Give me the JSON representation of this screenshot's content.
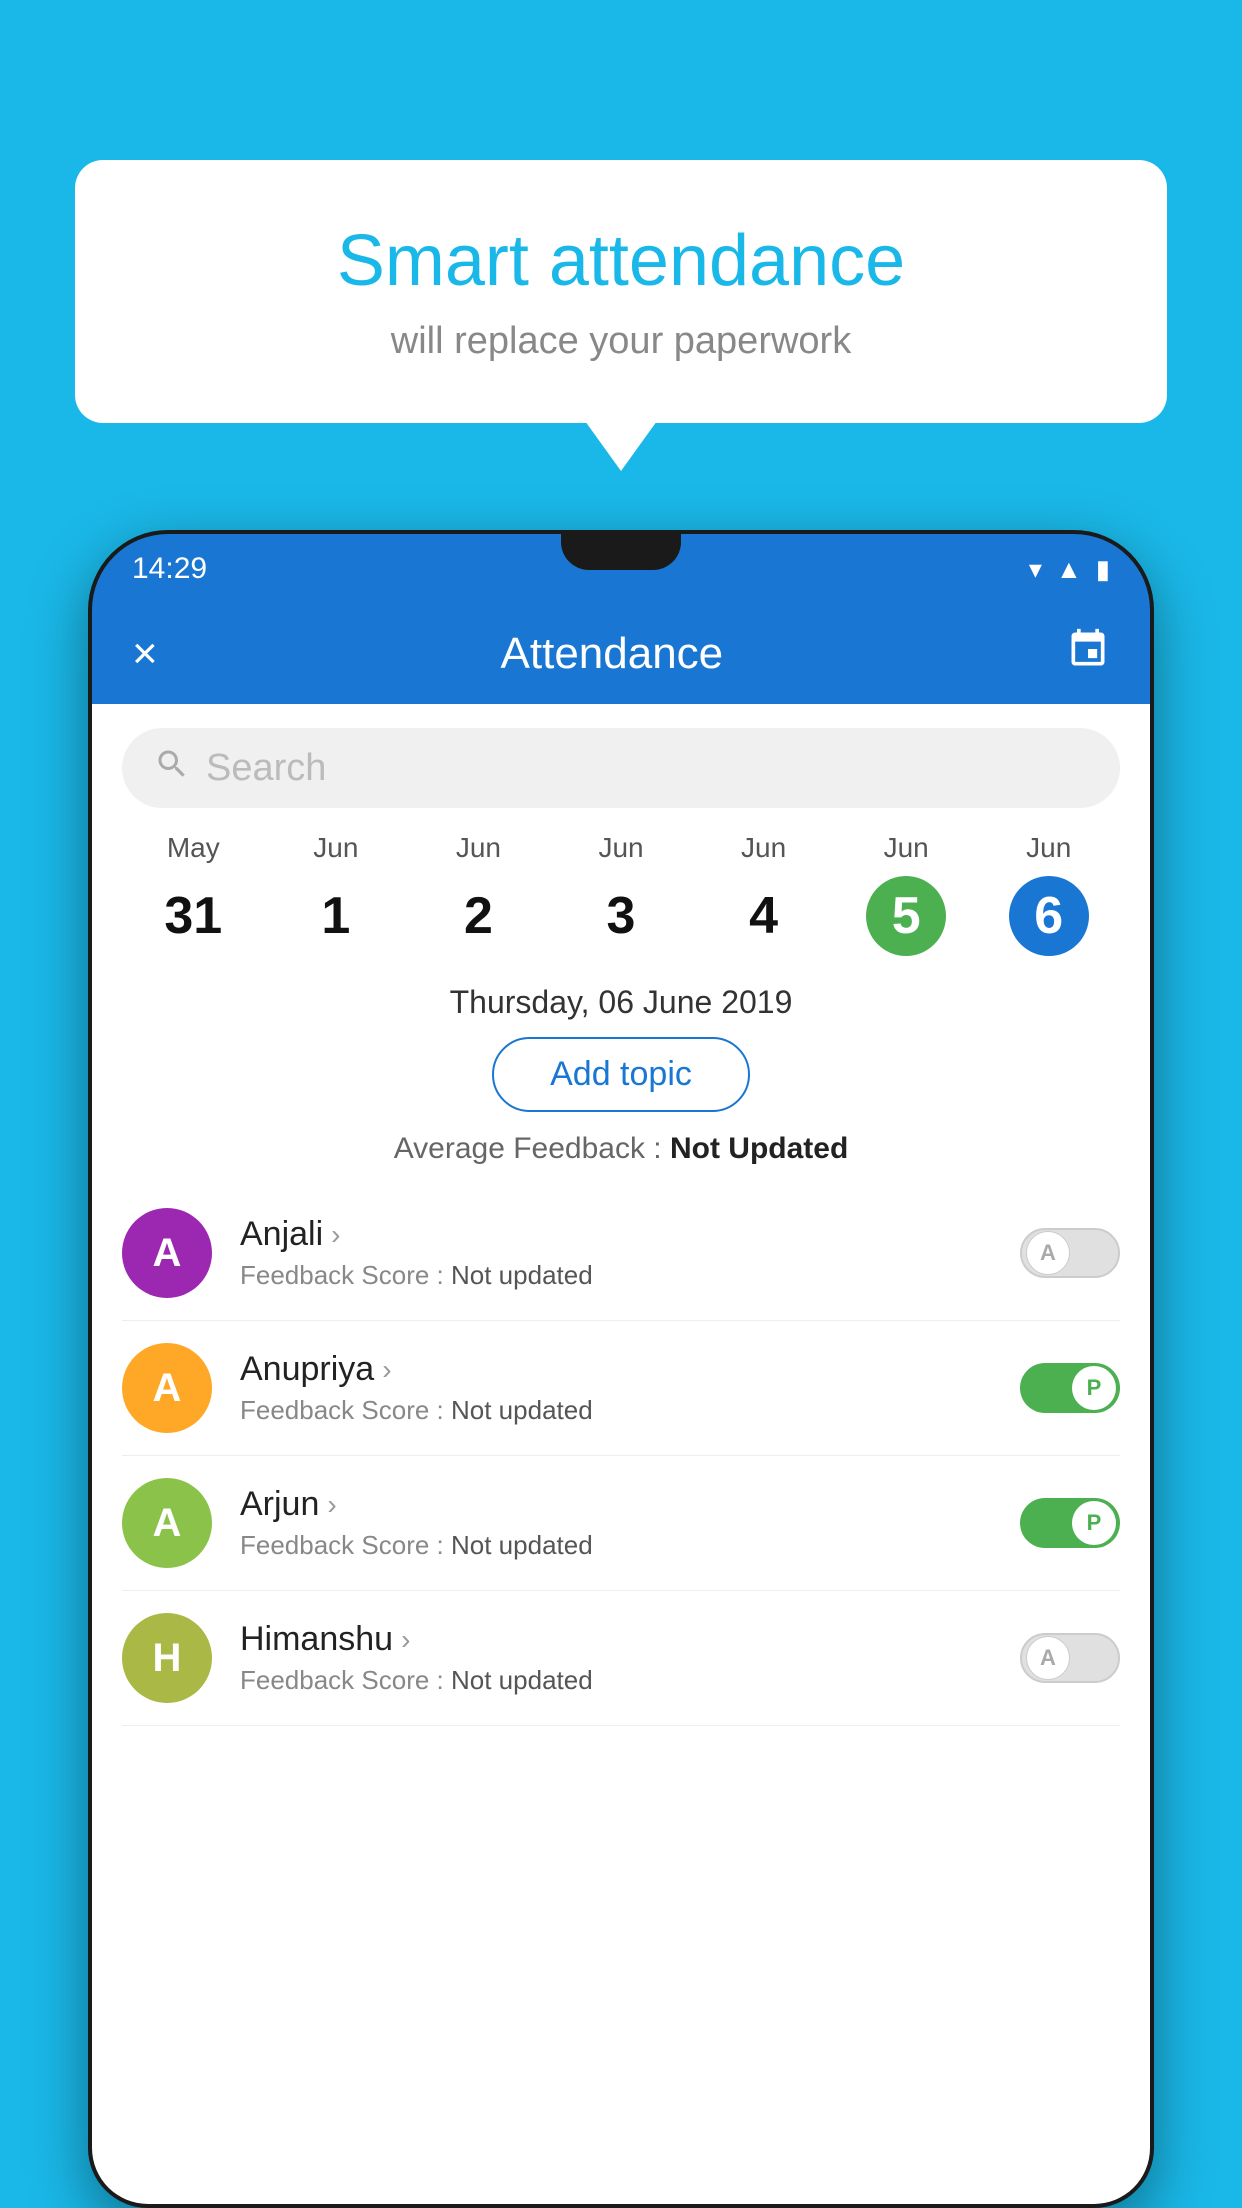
{
  "background_color": "#1ab8e8",
  "bubble": {
    "title": "Smart attendance",
    "subtitle": "will replace your paperwork"
  },
  "status_bar": {
    "time": "14:29",
    "icons": [
      "wifi",
      "signal",
      "battery"
    ]
  },
  "app_bar": {
    "title": "Attendance",
    "close_label": "×",
    "calendar_label": "📅"
  },
  "search": {
    "placeholder": "Search"
  },
  "dates": [
    {
      "month": "May",
      "day": "31",
      "state": "normal"
    },
    {
      "month": "Jun",
      "day": "1",
      "state": "normal"
    },
    {
      "month": "Jun",
      "day": "2",
      "state": "normal"
    },
    {
      "month": "Jun",
      "day": "3",
      "state": "normal"
    },
    {
      "month": "Jun",
      "day": "4",
      "state": "normal"
    },
    {
      "month": "Jun",
      "day": "5",
      "state": "today"
    },
    {
      "month": "Jun",
      "day": "6",
      "state": "selected"
    }
  ],
  "selected_date_label": "Thursday, 06 June 2019",
  "add_topic_label": "Add topic",
  "average_feedback_label": "Average Feedback : ",
  "average_feedback_value": "Not Updated",
  "students": [
    {
      "name": "Anjali",
      "initial": "A",
      "avatar_color": "#9c27b0",
      "feedback_label": "Feedback Score : ",
      "feedback_value": "Not updated",
      "attendance": "absent"
    },
    {
      "name": "Anupriya",
      "initial": "A",
      "avatar_color": "#ffa726",
      "feedback_label": "Feedback Score : ",
      "feedback_value": "Not updated",
      "attendance": "present"
    },
    {
      "name": "Arjun",
      "initial": "A",
      "avatar_color": "#8bc34a",
      "feedback_label": "Feedback Score : ",
      "feedback_value": "Not updated",
      "attendance": "present"
    },
    {
      "name": "Himanshu",
      "initial": "H",
      "avatar_color": "#aab846",
      "feedback_label": "Feedback Score : ",
      "feedback_value": "Not updated",
      "attendance": "absent"
    }
  ],
  "toggle_absent_label": "A",
  "toggle_present_label": "P"
}
